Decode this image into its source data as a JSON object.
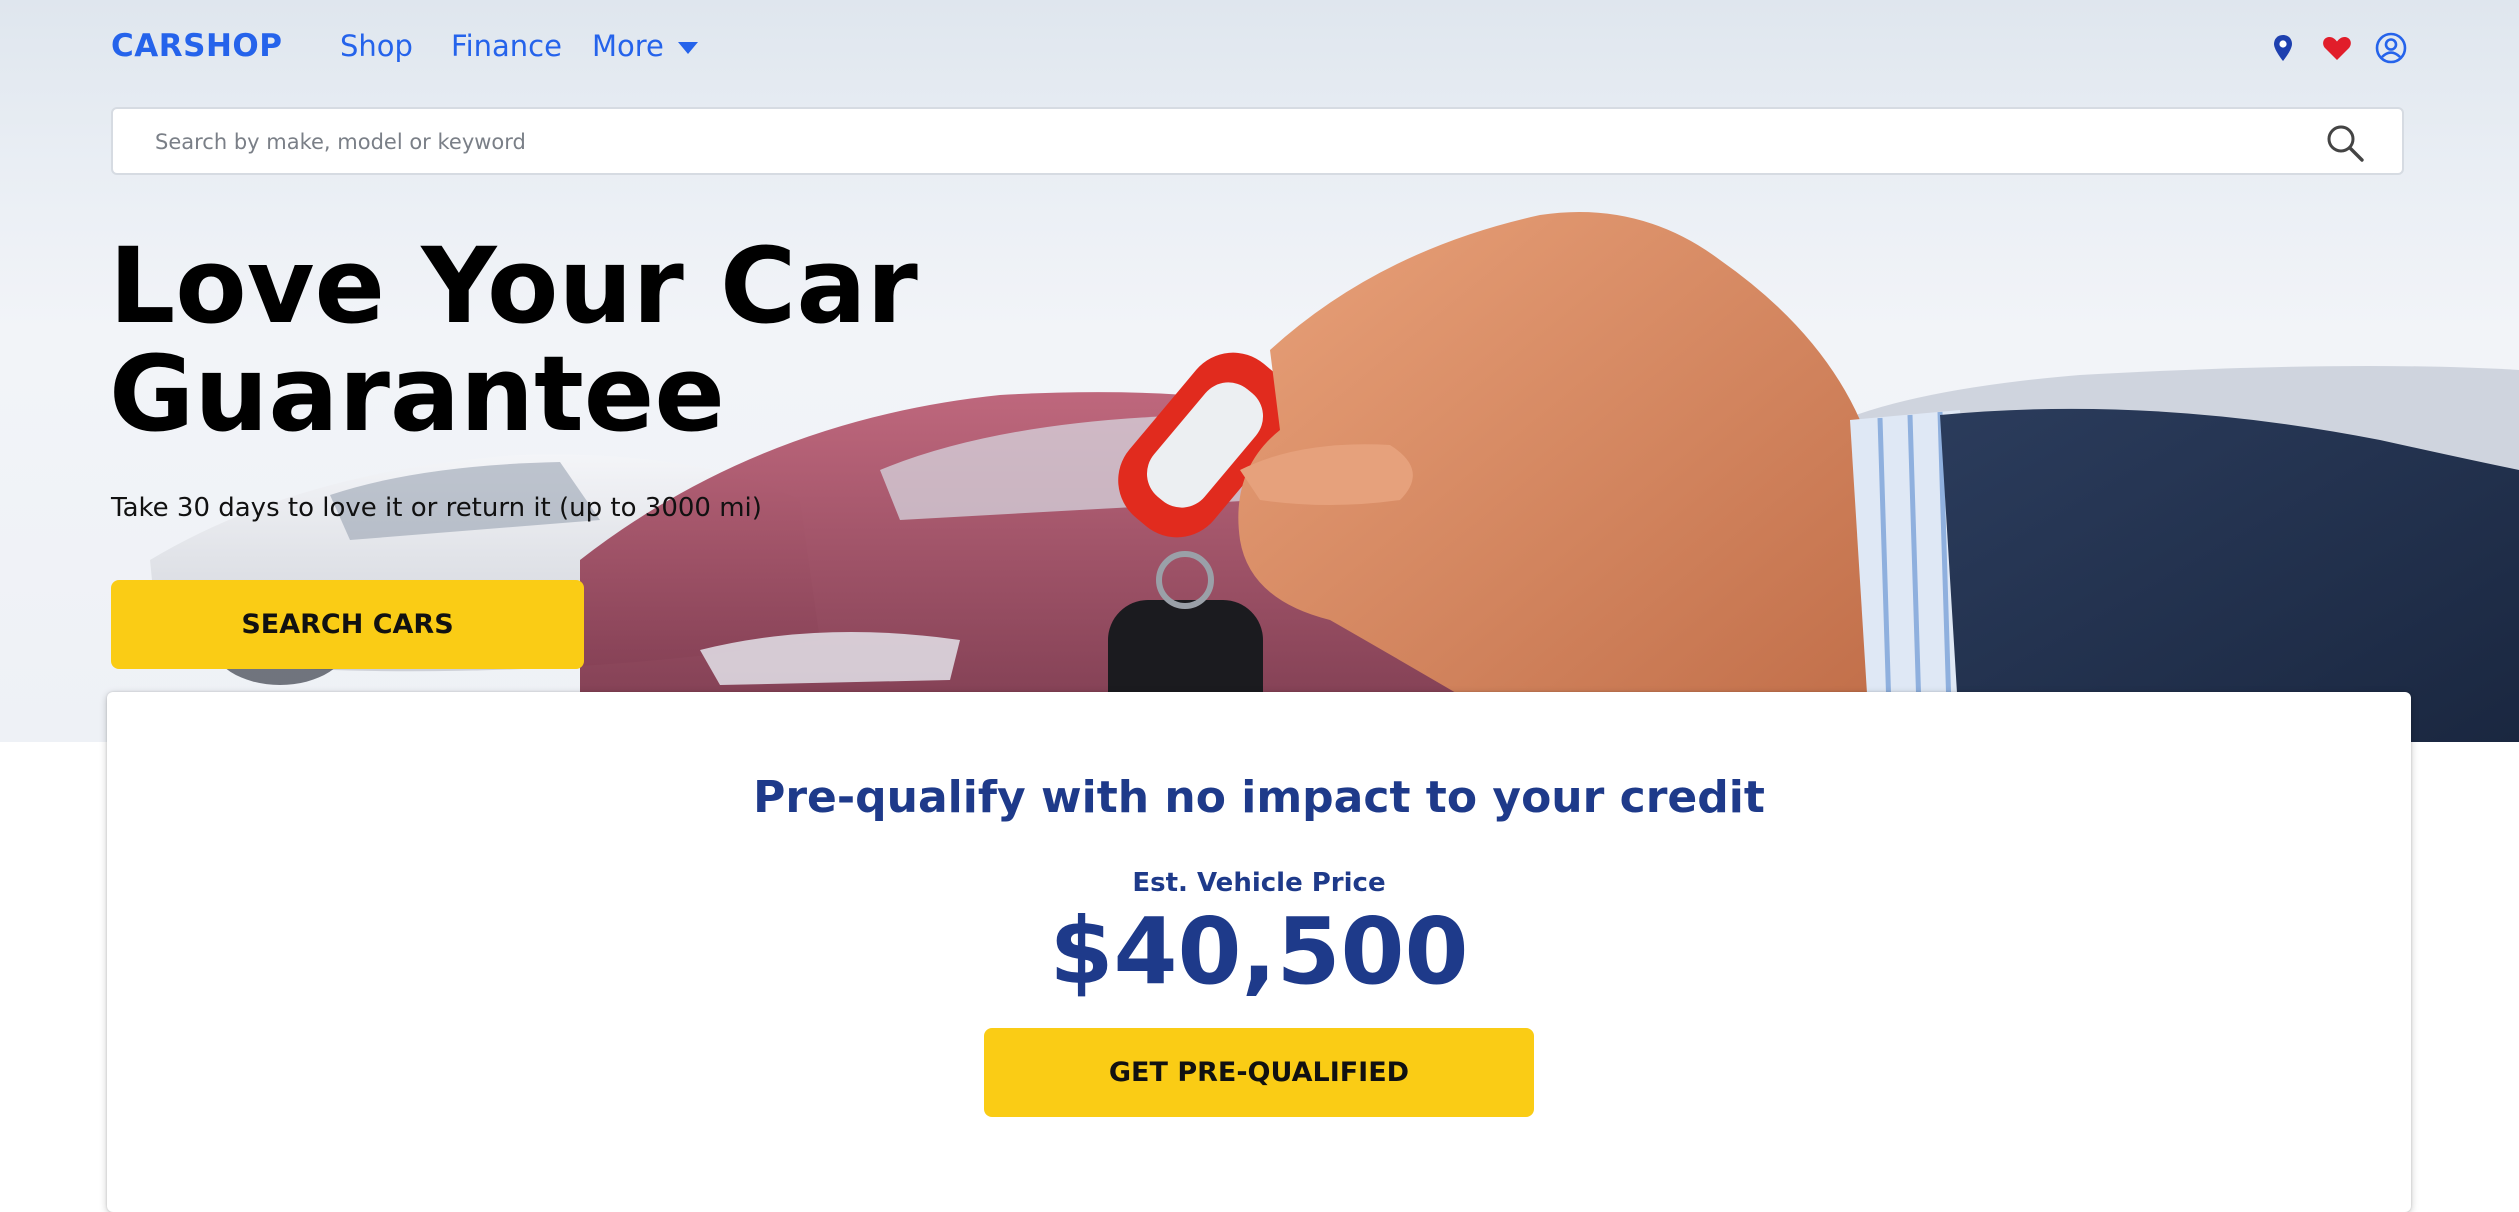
{
  "nav": {
    "logo": "CARSHOP",
    "links": [
      {
        "label": "Shop"
      },
      {
        "label": "Finance"
      },
      {
        "label": "More"
      }
    ],
    "icons": [
      "map-pin-icon",
      "heart-icon",
      "user-account-icon"
    ]
  },
  "search": {
    "placeholder": "Search by make, model or keyword",
    "value": ""
  },
  "hero": {
    "title_line1": "Love Your Car",
    "title_line2": "Guarantee",
    "subtitle": "Take 30 days to love it or return it (up to 3000 mi)",
    "cta_label": "SEARCH CARS"
  },
  "prequalify": {
    "title": "Pre-qualify with no impact to your credit",
    "price_label": "Est. Vehicle Price",
    "price_value": "$40,500",
    "cta_label": "GET PRE-QUALIFIED"
  },
  "colors": {
    "brand_blue": "#2563eb",
    "dark_blue": "#1e3a8a",
    "cta_yellow": "#facc15",
    "heart_red": "#e11d2a"
  }
}
